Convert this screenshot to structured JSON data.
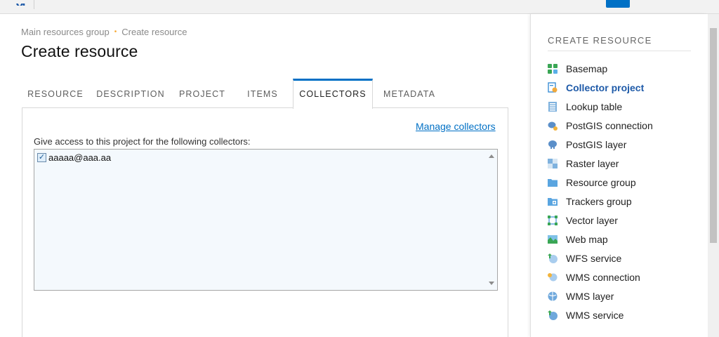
{
  "breadcrumb": {
    "items": [
      "Main resources group",
      "Create resource"
    ],
    "separator": "•"
  },
  "page": {
    "title": "Create resource"
  },
  "tabs": [
    {
      "label": "RESOURCE"
    },
    {
      "label": "DESCRIPTION"
    },
    {
      "label": "PROJECT"
    },
    {
      "label": "ITEMS"
    },
    {
      "label": "COLLECTORS",
      "active": true
    },
    {
      "label": "METADATA"
    }
  ],
  "collectors": {
    "manage_link": "Manage collectors",
    "field_label": "Give access to this project for the following collectors:",
    "items": [
      {
        "label": "aaaaa@aaa.aa",
        "checked": true
      }
    ]
  },
  "sidebar": {
    "title": "CREATE RESOURCE",
    "items": [
      {
        "label": "Basemap",
        "icon": "basemap-icon"
      },
      {
        "label": "Collector project",
        "icon": "collector-project-icon",
        "active": true
      },
      {
        "label": "Lookup table",
        "icon": "lookup-table-icon"
      },
      {
        "label": "PostGIS connection",
        "icon": "postgis-connection-icon"
      },
      {
        "label": "PostGIS layer",
        "icon": "postgis-layer-icon"
      },
      {
        "label": "Raster layer",
        "icon": "raster-layer-icon"
      },
      {
        "label": "Resource group",
        "icon": "folder-icon"
      },
      {
        "label": "Trackers group",
        "icon": "trackers-group-icon"
      },
      {
        "label": "Vector layer",
        "icon": "vector-layer-icon"
      },
      {
        "label": "Web map",
        "icon": "web-map-icon"
      },
      {
        "label": "WFS service",
        "icon": "wfs-service-icon"
      },
      {
        "label": "WMS connection",
        "icon": "wms-connection-icon"
      },
      {
        "label": "WMS layer",
        "icon": "wms-layer-icon"
      },
      {
        "label": "WMS service",
        "icon": "wms-service-icon"
      }
    ]
  },
  "colors": {
    "accent": "#0070c5",
    "active_link": "#1e5aa8",
    "breadcrumb_dot": "#f7a934"
  }
}
